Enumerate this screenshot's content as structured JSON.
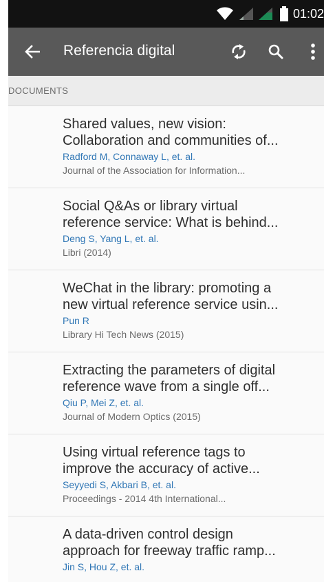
{
  "status_bar": {
    "time": "01:02"
  },
  "app_bar": {
    "title": "Referencia digital",
    "back_icon": "arrow-left-icon",
    "refresh_icon": "refresh-icon",
    "search_icon": "search-icon",
    "more_icon": "more-vert-icon"
  },
  "section": {
    "label": "DOCUMENTS"
  },
  "documents": [
    {
      "title_line1": "Shared values, new vision:",
      "title_line2": "Collaboration and communities of...",
      "authors": "Radford M, Connaway L, et. al.",
      "source": "Journal of the Association for Information..."
    },
    {
      "title_line1": "Social Q&As or library virtual",
      "title_line2": "reference service: What is behind...",
      "authors": "Deng S, Yang L, et. al.",
      "source": "Libri (2014)"
    },
    {
      "title_line1": "WeChat in the library: promoting a",
      "title_line2": "new virtual reference service usin...",
      "authors": "Pun R",
      "source": "Library Hi Tech News (2015)"
    },
    {
      "title_line1": "Extracting the parameters of digital",
      "title_line2": "reference wave from a single off...",
      "authors": "Qiu P, Mei Z, et. al.",
      "source": "Journal of Modern Optics (2015)"
    },
    {
      "title_line1": "Using virtual reference tags to",
      "title_line2": "improve the accuracy of active...",
      "authors": "Seyyedi S, Akbari B, et. al.",
      "source": "Proceedings - 2014 4th International..."
    },
    {
      "title_line1": "A data-driven control design",
      "title_line2": "approach for freeway traffic ramp...",
      "authors": "Jin S, Hou Z, et. al.",
      "source": ""
    }
  ],
  "colors": {
    "status_bar": "#121212",
    "app_bar": "#595959",
    "section_header": "#ececec",
    "author_link": "#2f76b5",
    "title_text": "#303030",
    "source_text": "#6b6b6b"
  }
}
